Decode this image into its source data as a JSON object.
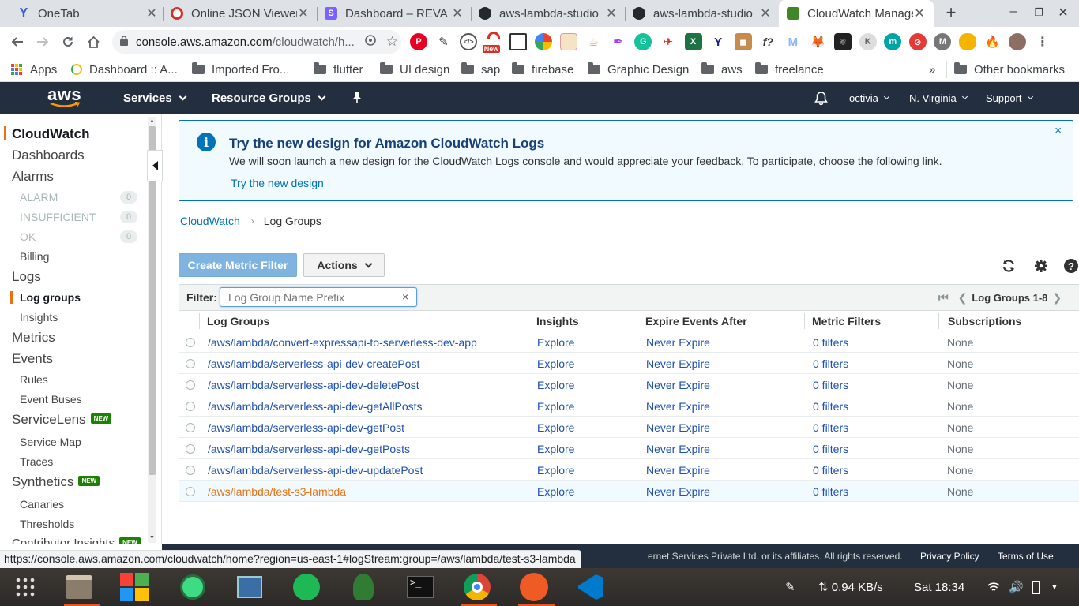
{
  "browser": {
    "tabs": [
      {
        "title": "OneTab",
        "favicon": "onetab-icon",
        "color": "#3b5bdb"
      },
      {
        "title": "Online JSON Viewer",
        "favicon": "json-viewer-icon",
        "color": "#d93025"
      },
      {
        "title": "Dashboard – REVA",
        "favicon": "dashboard-icon",
        "color": "#7b61ff"
      },
      {
        "title": "aws-lambda-studio",
        "favicon": "github-icon",
        "color": "#24292e"
      },
      {
        "title": "aws-lambda-studio",
        "favicon": "github-icon",
        "color": "#24292e"
      },
      {
        "title": "CloudWatch Management Console",
        "favicon": "aws-icon",
        "color": "#3f8624"
      }
    ],
    "url_host": "console.aws.amazon.com",
    "url_rest": "/cloudwatch/h...",
    "new_badge": "New",
    "bookmarks": [
      {
        "label": "Apps",
        "icon": "apps-grid-icon"
      },
      {
        "label": "Dashboard :: A...",
        "icon": "dashboard-favicon-icon"
      },
      {
        "label": "Imported Fro...",
        "icon": "folder-icon"
      },
      {
        "label": "flutter",
        "icon": "folder-icon"
      },
      {
        "label": "UI design",
        "icon": "folder-icon"
      },
      {
        "label": "sap",
        "icon": "folder-icon"
      },
      {
        "label": "firebase",
        "icon": "folder-icon"
      },
      {
        "label": "Graphic Design",
        "icon": "folder-icon"
      },
      {
        "label": "aws",
        "icon": "folder-icon"
      },
      {
        "label": "freelance",
        "icon": "folder-icon"
      }
    ],
    "bookmarks_overflow": "»",
    "other_bookmarks": "Other bookmarks",
    "status_url": "https://console.aws.amazon.com/cloudwatch/home?region=us-east-1#logStream:group=/aws/lambda/test-s3-lambda"
  },
  "aws_header": {
    "logo": "aws",
    "services": "Services",
    "resource_groups": "Resource Groups",
    "pin_icon": "pushpin-icon",
    "bell_icon": "bell-icon",
    "user": "octivia",
    "region": "N. Virginia",
    "support": "Support"
  },
  "sidebar": {
    "cloudwatch": "CloudWatch",
    "dashboards": "Dashboards",
    "alarms": "Alarms",
    "alarm_states": [
      {
        "label": "ALARM",
        "count": "0"
      },
      {
        "label": "INSUFFICIENT",
        "count": "0"
      },
      {
        "label": "OK",
        "count": "0"
      }
    ],
    "billing": "Billing",
    "logs": "Logs",
    "log_groups": "Log groups",
    "insights": "Insights",
    "metrics": "Metrics",
    "events": "Events",
    "rules": "Rules",
    "event_buses": "Event Buses",
    "servicelens": "ServiceLens",
    "service_map": "Service Map",
    "traces": "Traces",
    "synthetics": "Synthetics",
    "canaries": "Canaries",
    "thresholds": "Thresholds",
    "contributor_insights": "Contributor Insights",
    "new_badge": "NEW"
  },
  "banner": {
    "title": "Try the new design for Amazon CloudWatch Logs",
    "text": "We will soon launch a new design for the CloudWatch Logs console and would appreciate your feedback. To participate, choose the following link.",
    "link": "Try the new design",
    "close": "×"
  },
  "breadcrumb": {
    "root": "CloudWatch",
    "sep": "›",
    "current": "Log Groups"
  },
  "toolbar": {
    "create_metric_filter": "Create Metric Filter",
    "actions": "Actions"
  },
  "filter": {
    "label": "Filter:",
    "placeholder": "Log Group Name Prefix",
    "clear": "×",
    "pager": "Log Groups 1-8"
  },
  "table": {
    "headers": [
      "Log Groups",
      "Insights",
      "Expire Events After",
      "Metric Filters",
      "Subscriptions"
    ],
    "rows": [
      {
        "name": "/aws/lambda/convert-expressapi-to-serverless-dev-app",
        "insights": "Explore",
        "expire": "Never Expire",
        "filters": "0 filters",
        "subs": "None"
      },
      {
        "name": "/aws/lambda/serverless-api-dev-createPost",
        "insights": "Explore",
        "expire": "Never Expire",
        "filters": "0 filters",
        "subs": "None"
      },
      {
        "name": "/aws/lambda/serverless-api-dev-deletePost",
        "insights": "Explore",
        "expire": "Never Expire",
        "filters": "0 filters",
        "subs": "None"
      },
      {
        "name": "/aws/lambda/serverless-api-dev-getAllPosts",
        "insights": "Explore",
        "expire": "Never Expire",
        "filters": "0 filters",
        "subs": "None"
      },
      {
        "name": "/aws/lambda/serverless-api-dev-getPost",
        "insights": "Explore",
        "expire": "Never Expire",
        "filters": "0 filters",
        "subs": "None"
      },
      {
        "name": "/aws/lambda/serverless-api-dev-getPosts",
        "insights": "Explore",
        "expire": "Never Expire",
        "filters": "0 filters",
        "subs": "None"
      },
      {
        "name": "/aws/lambda/serverless-api-dev-updatePost",
        "insights": "Explore",
        "expire": "Never Expire",
        "filters": "0 filters",
        "subs": "None"
      },
      {
        "name": "/aws/lambda/test-s3-lambda",
        "insights": "Explore",
        "expire": "Never Expire",
        "filters": "0 filters",
        "subs": "None"
      }
    ]
  },
  "footer": {
    "copyright_tail": "ernet Services Private Ltd. or its affiliates. All rights reserved.",
    "privacy": "Privacy Policy",
    "terms": "Terms of Use"
  },
  "taskbar": {
    "net_speed": "⇅ 0.94 KB/s",
    "clock": "Sat 18:34"
  },
  "colors": {
    "aws_nav": "#232f3e",
    "accent_orange": "#ec7211",
    "link_blue": "#0073bb",
    "new_badge_green": "#1d8102"
  }
}
